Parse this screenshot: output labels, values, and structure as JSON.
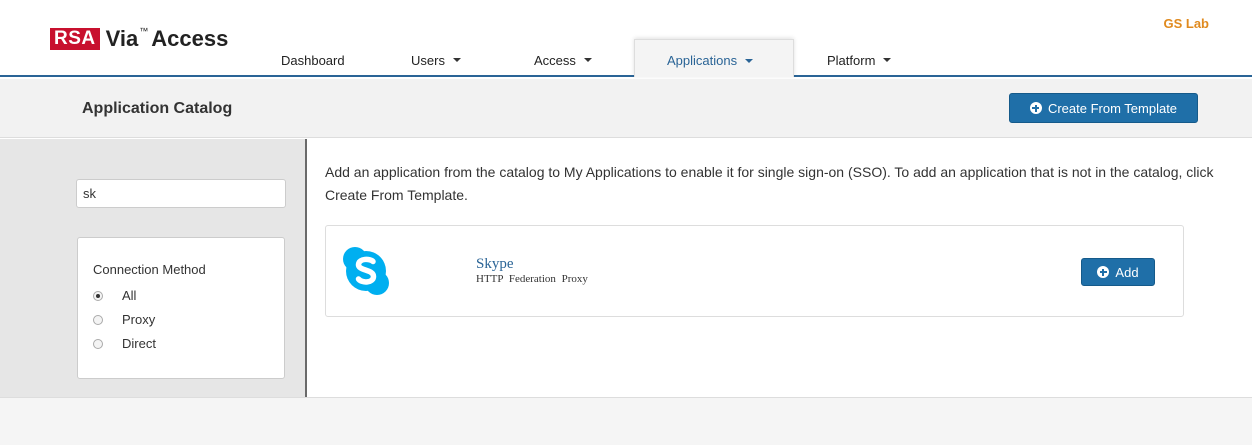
{
  "header": {
    "logo": {
      "brand": "RSA",
      "product": "Via",
      "tm": "™",
      "suffix": "Access"
    },
    "org_name": "GS Lab",
    "nav": [
      {
        "label": "Dashboard",
        "has_caret": false,
        "active": false
      },
      {
        "label": "Users",
        "has_caret": true,
        "active": false
      },
      {
        "label": "Access",
        "has_caret": true,
        "active": false
      },
      {
        "label": "Applications",
        "has_caret": true,
        "active": true
      },
      {
        "label": "Platform",
        "has_caret": true,
        "active": false
      }
    ]
  },
  "page": {
    "title": "Application Catalog",
    "create_button_label": "Create From Template",
    "create_button_icon": "plus-circle-icon"
  },
  "sidebar": {
    "search_value": "sk",
    "filter": {
      "title": "Connection Method",
      "options": [
        {
          "label": "All",
          "checked": true
        },
        {
          "label": "Proxy",
          "checked": false
        },
        {
          "label": "Direct",
          "checked": false
        }
      ]
    }
  },
  "main": {
    "intro": "Add an application from the catalog to My Applications to enable it for single sign-on (SSO). To add an application that is not in the catalog, click Create From Template.",
    "apps": [
      {
        "name": "Skype",
        "types": "HTTP Federation Proxy",
        "icon": "skype-logo-icon",
        "add_label": "Add"
      }
    ]
  },
  "colors": {
    "primary_button": "#1f6fa8",
    "nav_underline": "#2a6496",
    "org_name": "#e08a1e",
    "rsa_red": "#c8102e",
    "skype_blue": "#00aff0"
  }
}
